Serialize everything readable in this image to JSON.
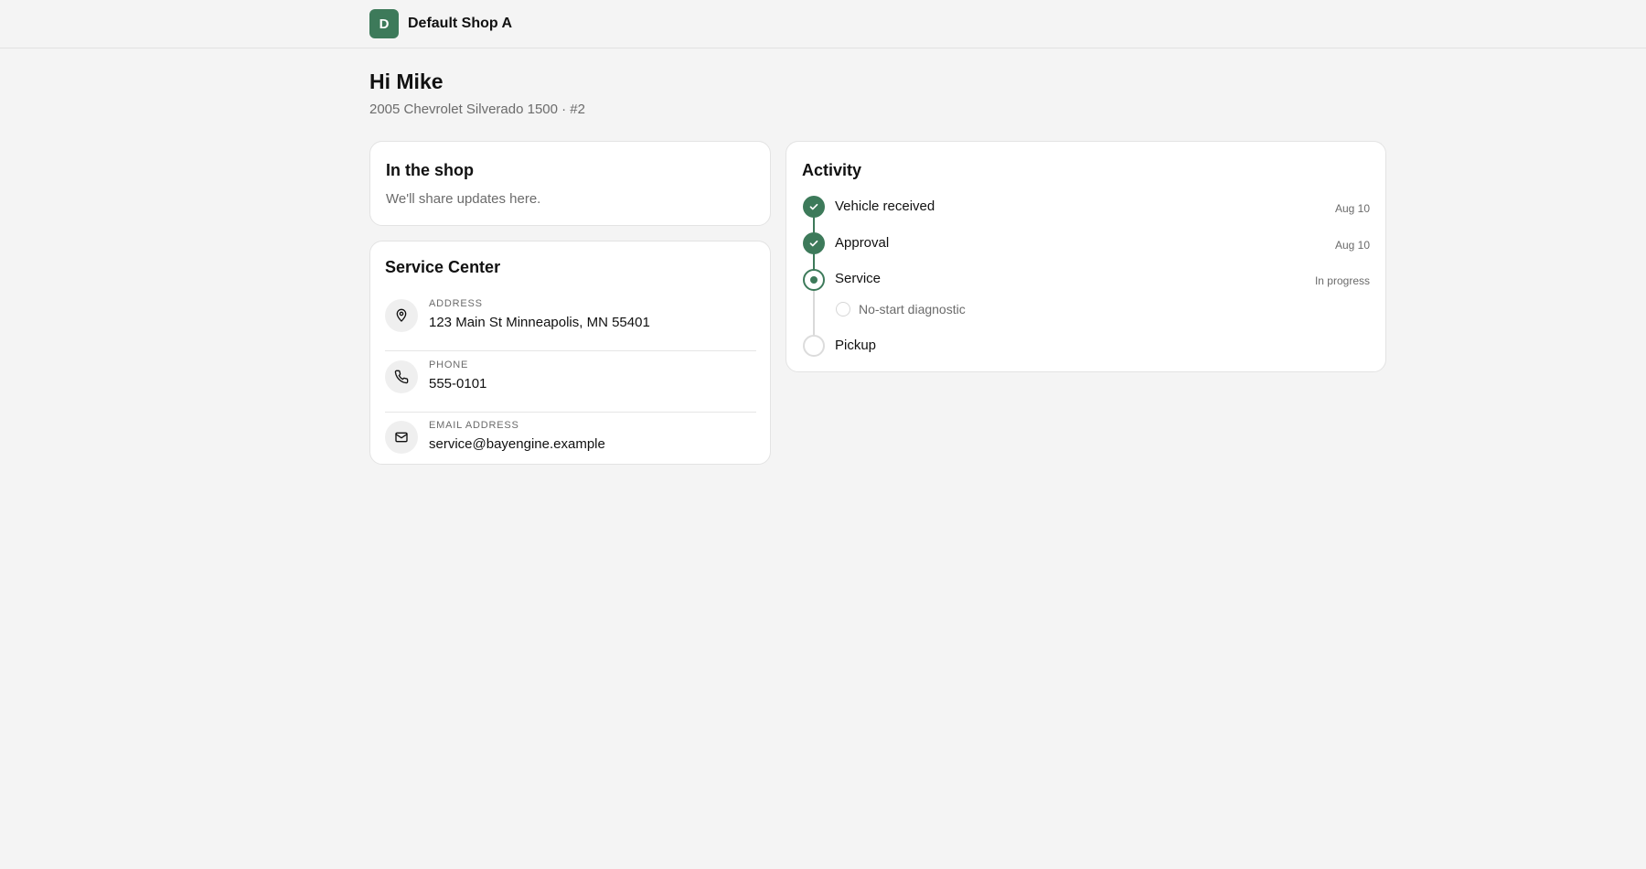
{
  "header": {
    "logo_letter": "D",
    "shop_name": "Default Shop A"
  },
  "greeting": "Hi Mike",
  "vehicle": "2005 Chevrolet Silverado 1500 · #2",
  "status_card": {
    "title": "In the shop",
    "subtitle": "We'll share updates here."
  },
  "service_center": {
    "title": "Service Center",
    "address": {
      "label": "ADDRESS",
      "value": "123 Main St Minneapolis, MN 55401",
      "icon": "map-pin-icon"
    },
    "phone": {
      "label": "PHONE",
      "value": "555-0101",
      "icon": "phone-icon"
    },
    "email": {
      "label": "EMAIL ADDRESS",
      "value": "service@bayengine.example",
      "icon": "mail-icon"
    }
  },
  "activity": {
    "title": "Activity",
    "steps": [
      {
        "label": "Vehicle received",
        "meta": "Aug 10",
        "status": "done"
      },
      {
        "label": "Approval",
        "meta": "Aug 10",
        "status": "done"
      },
      {
        "label": "Service",
        "meta": "In progress",
        "status": "active"
      },
      {
        "label": "Pickup",
        "meta": "",
        "status": "pending"
      }
    ],
    "substeps": [
      {
        "label": "No-start diagnostic",
        "status": "pending"
      }
    ]
  },
  "colors": {
    "accent": "#3d7a5a",
    "background": "#f4f4f4",
    "card": "#ffffff",
    "muted_text": "#6b6b6b"
  }
}
